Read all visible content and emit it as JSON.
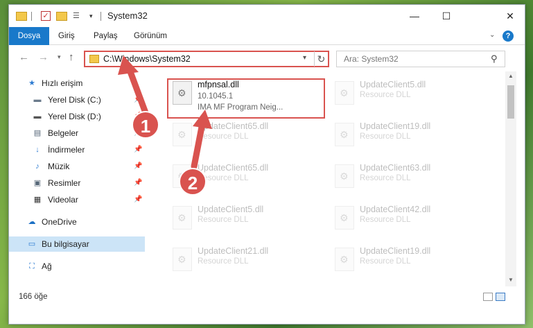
{
  "window": {
    "title": "System32",
    "controls": {
      "minimize": "—",
      "maximize": "☐",
      "close": "✕"
    }
  },
  "ribbon": {
    "tabs": [
      "Dosya",
      "Giriş",
      "Paylaş",
      "Görünüm"
    ],
    "help": "?"
  },
  "address": {
    "path": "C:\\Windows\\System32",
    "refresh": "↻"
  },
  "search": {
    "placeholder": "Ara: System32"
  },
  "sidebar": {
    "items": [
      {
        "label": "Hızlı erişim",
        "icon": "star-icon",
        "glyph": "★",
        "color": "#2d7bd1"
      },
      {
        "label": "Yerel Disk (C:)",
        "icon": "drive-icon",
        "glyph": "▬",
        "color": "#6b7b8c",
        "pinned": true
      },
      {
        "label": "Yerel Disk (D:)",
        "icon": "drive-icon",
        "glyph": "▬",
        "color": "#555555",
        "pinned": true
      },
      {
        "label": "Belgeler",
        "icon": "document-icon",
        "glyph": "▤",
        "color": "#556677",
        "pinned": true
      },
      {
        "label": "İndirmeler",
        "icon": "download-icon",
        "glyph": "↓",
        "color": "#2d7bd1",
        "pinned": true
      },
      {
        "label": "Müzik",
        "icon": "music-icon",
        "glyph": "♪",
        "color": "#2d7bd1",
        "pinned": true
      },
      {
        "label": "Resimler",
        "icon": "picture-icon",
        "glyph": "▣",
        "color": "#556677",
        "pinned": true
      },
      {
        "label": "Videolar",
        "icon": "video-icon",
        "glyph": "▦",
        "color": "#333333",
        "pinned": true
      },
      {
        "label": "OneDrive",
        "icon": "cloud-icon",
        "glyph": "☁",
        "color": "#1a6fc4"
      },
      {
        "label": "Bu bilgisayar",
        "icon": "computer-icon",
        "glyph": "▭",
        "color": "#2d7bd1"
      },
      {
        "label": "Ağ",
        "icon": "network-icon",
        "glyph": "⛶",
        "color": "#2d7bd1"
      }
    ],
    "pin_glyph": "📌"
  },
  "files": {
    "main": {
      "name": "mfpnsal.dll",
      "version": "10.1045.1",
      "description": "IMA MF Program Neig..."
    },
    "faded": [
      {
        "name": "UpdateClient5.dll",
        "desc": "Resource DLL"
      },
      {
        "name": "UpdateClient65.dll",
        "desc": "Resource DLL"
      },
      {
        "name": "UpdateClient19.dll",
        "desc": "Resource DLL"
      },
      {
        "name": "UpdateClient65.dll",
        "desc": "Resource DLL"
      },
      {
        "name": "UpdateClient63.dll",
        "desc": "Resource DLL"
      },
      {
        "name": "UpdateClient5.dll",
        "desc": "Resource DLL"
      },
      {
        "name": "UpdateClient42.dll",
        "desc": "Resource DLL"
      },
      {
        "name": "UpdateClient21.dll",
        "desc": "Resource DLL"
      },
      {
        "name": "UpdateClient19.dll",
        "desc": "Resource DLL"
      }
    ]
  },
  "status": {
    "count": "166 öğe"
  },
  "annotations": {
    "step1": "1",
    "step2": "2",
    "color": "#d9534f"
  }
}
